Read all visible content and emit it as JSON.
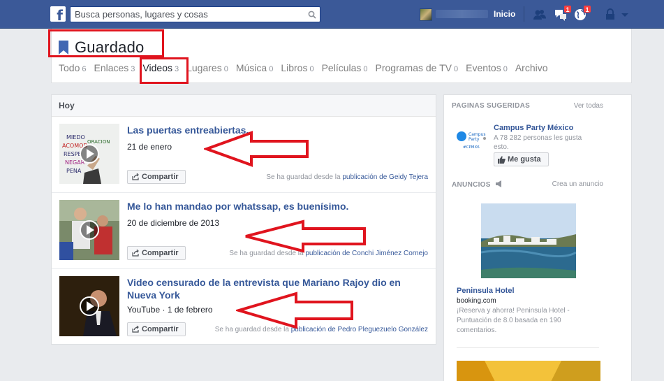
{
  "topbar": {
    "logo_letter": "f",
    "search_placeholder": "Busca personas, lugares y cosas",
    "home_label": "Inicio",
    "friend_requests_badge": "",
    "messages_badge": "1",
    "notifications_badge": "1"
  },
  "header": {
    "title": "Guardado",
    "tabs": [
      {
        "label": "Todo",
        "count": "6"
      },
      {
        "label": "Enlaces",
        "count": "3"
      },
      {
        "label": "Videos",
        "count": "3"
      },
      {
        "label": "Lugares",
        "count": "0"
      },
      {
        "label": "Música",
        "count": "0"
      },
      {
        "label": "Libros",
        "count": "0"
      },
      {
        "label": "Películas",
        "count": "0"
      },
      {
        "label": "Programas de TV",
        "count": "0"
      },
      {
        "label": "Eventos",
        "count": "0"
      },
      {
        "label": "Archivo",
        "count": ""
      }
    ]
  },
  "main": {
    "section_label": "Hoy",
    "share_label": "Compartir",
    "saved_prefix": "Se ha guardad desde la",
    "items": [
      {
        "title": "Las puertas entreabiertas.",
        "meta": "21 de enero",
        "source_link": "publicación de Geidy Tejera"
      },
      {
        "title": "Me lo han mandao por whatssap, es buenísimo.",
        "meta": "20 de diciembre de 2013",
        "source_link": "publicación de Conchi Jiménez Cornejo"
      },
      {
        "title": "Video censurado de la entrevista que Mariano Rajoy dio en Nueva York",
        "meta": "YouTube · 1 de febrero",
        "source_link": "publicación de Pedro Pleguezuelo González"
      }
    ]
  },
  "sidebar": {
    "suggested_head": "PAGINAS SUGERIDAS",
    "see_all": "Ver todas",
    "page_name": "Campus Party México",
    "page_likes": "A 78 282 personas les gusta esto.",
    "like_label": "Me gusta",
    "logo_text_1": "Campus",
    "logo_text_2": "Party",
    "logo_tag": "#CPMX6",
    "ads_head": "ANUNCIOS",
    "create_ad": "Crea un anuncio",
    "ad_title": "Peninsula Hotel",
    "ad_domain": "booking.com",
    "ad_desc": "¡Reserva y ahorra! Peninsula Hotel - Puntuación de 8.0 basada en 190 comentarios."
  },
  "colors": {
    "brand_blue": "#3b5998",
    "link_blue": "#365899",
    "annotation_red": "#e0141e",
    "badge_red": "#fa3e3e"
  }
}
